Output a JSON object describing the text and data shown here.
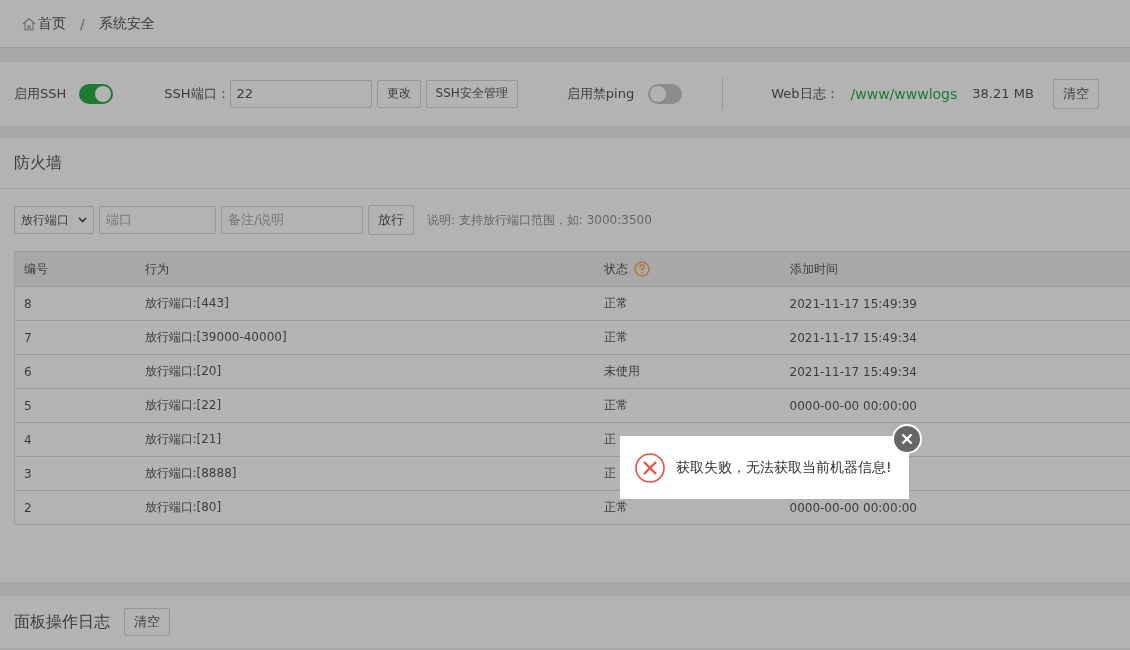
{
  "breadcrumb": {
    "home": "首页",
    "separator": "/",
    "current": "系统安全"
  },
  "settings": {
    "ssh_label": "启用SSH",
    "ssh_on": true,
    "port_label": "SSH端口：",
    "port_value": "22",
    "change_button": "更改",
    "ssh_manage_button": "SSH安全管理",
    "ping_label": "启用禁ping",
    "ping_on": false,
    "web_log_label": "Web日志：",
    "web_log_path": "/www/wwwlogs",
    "web_log_size": "38.21 MB",
    "clear_button": "清空"
  },
  "firewall": {
    "title": "防火墙",
    "type_select": "放行端口",
    "port_placeholder": "端口",
    "note_placeholder": "备注/说明",
    "allow_button": "放行",
    "hint": "说明: 支持放行端口范围，如: 3000:3500",
    "columns": [
      "编号",
      "行为",
      "状态",
      "添加时间"
    ],
    "rows": [
      {
        "id": "8",
        "action": "放行端口:[443]",
        "status": "正常",
        "time": "2021-11-17 15:49:39"
      },
      {
        "id": "7",
        "action": "放行端口:[39000-40000]",
        "status": "正常",
        "time": "2021-11-17 15:49:34"
      },
      {
        "id": "6",
        "action": "放行端口:[20]",
        "status": "未使用",
        "time": "2021-11-17 15:49:34"
      },
      {
        "id": "5",
        "action": "放行端口:[22]",
        "status": "正常",
        "time": "0000-00-00 00:00:00"
      },
      {
        "id": "4",
        "action": "放行端口:[21]",
        "status": "正"
      },
      {
        "id": "3",
        "action": "放行端口:[8888]",
        "status": "正"
      },
      {
        "id": "2",
        "action": "放行端口:[80]",
        "status": "正常",
        "time": "0000-00-00 00:00:00"
      }
    ]
  },
  "panel_log": {
    "title": "面板操作日志",
    "clear_button": "清空"
  },
  "dialog": {
    "message": "获取失败，无法获取当前机器信息!"
  }
}
